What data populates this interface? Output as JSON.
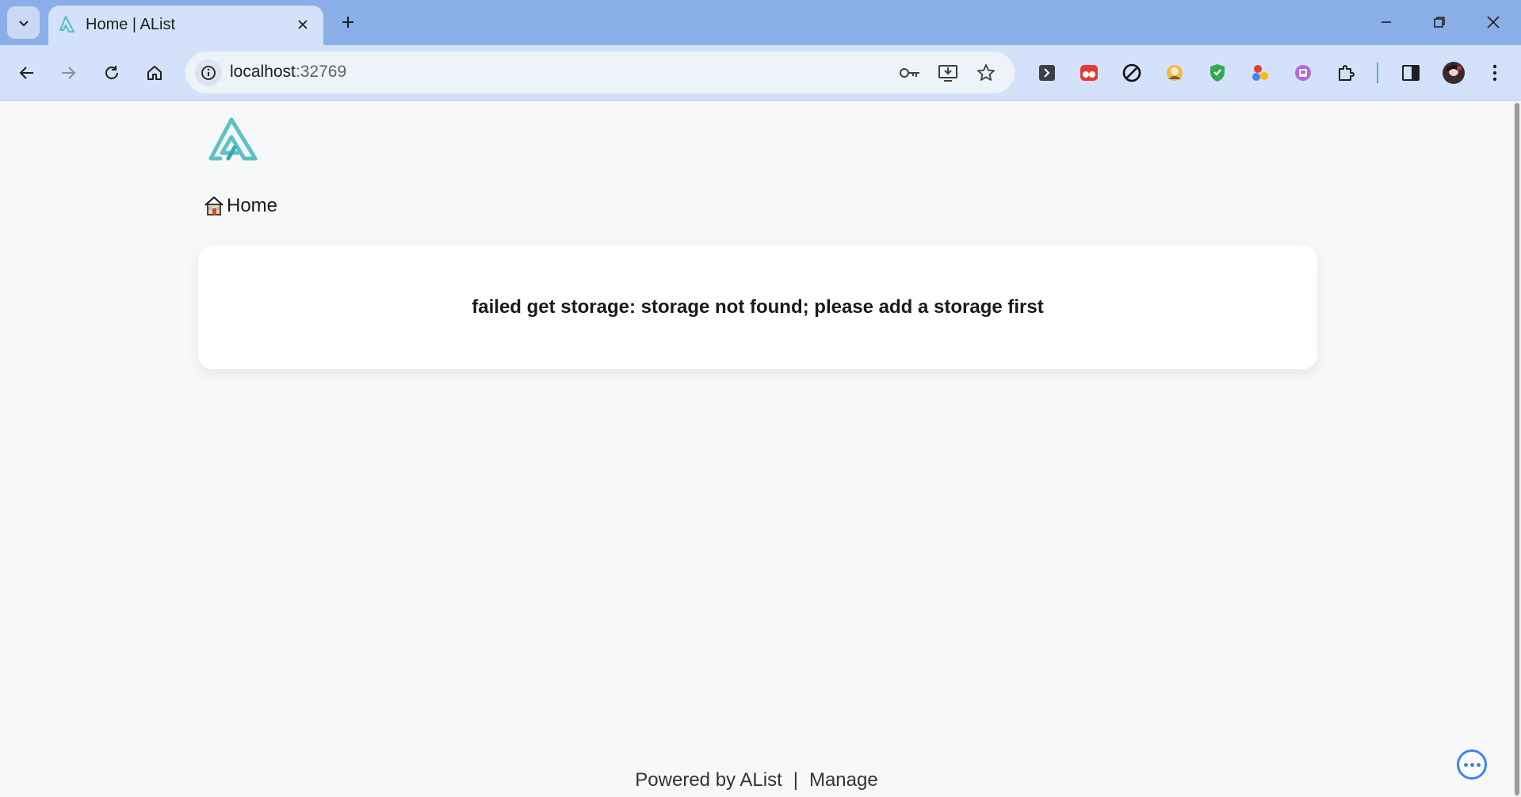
{
  "browser": {
    "tab_title": "Home | AList",
    "url_host": "localhost",
    "url_port": ":32769"
  },
  "page": {
    "breadcrumb_label": "Home",
    "error_message": "failed get storage: storage not found; please add a storage first",
    "footer_powered": "Powered by AList",
    "footer_separator": "|",
    "footer_manage": "Manage"
  },
  "icons": {
    "tab_search": "chevron-down-icon",
    "favicon": "alist-logo-icon",
    "logo": "alist-logo-icon",
    "breadcrumb": "home-icon",
    "float_button": "more-icon"
  },
  "colors": {
    "tabbar_bg": "#8aaee8",
    "toolbar_bg": "#d3e2fa",
    "page_bg": "#f7f8fa",
    "card_bg": "#ffffff",
    "logo_teal": "#5bc3c3",
    "accent_blue": "#3b82f6"
  }
}
